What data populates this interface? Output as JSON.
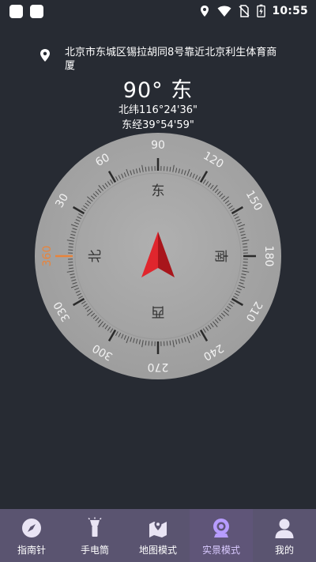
{
  "status_bar": {
    "time": "10:55",
    "icons": [
      "location-icon",
      "wifi-icon",
      "no-sim-icon",
      "battery-charging-icon"
    ]
  },
  "location": {
    "icon": "map-pin-icon",
    "address": "北京市东城区锡拉胡同8号靠近北京利生体育商厦"
  },
  "heading": {
    "text": "90°  东"
  },
  "coordinates": {
    "latitude": "北纬116°24'36\"",
    "longitude": "东经39°54'59\""
  },
  "compass": {
    "labels": [
      "90",
      "120",
      "150",
      "180",
      "210",
      "240",
      "270",
      "300",
      "330",
      "360",
      "30",
      "60"
    ],
    "directions": {
      "east": "东",
      "south": "南",
      "west": "西",
      "north": "北"
    },
    "highlight_label": "360",
    "highlight_color": "#E8843C",
    "needle_color": "#E0262D"
  },
  "nav": {
    "items": [
      {
        "label": "指南针",
        "icon": "compass-icon",
        "active": false
      },
      {
        "label": "手电筒",
        "icon": "flashlight-icon",
        "active": false
      },
      {
        "label": "地图模式",
        "icon": "map-icon",
        "active": false
      },
      {
        "label": "实景模式",
        "icon": "camera-icon",
        "active": true
      },
      {
        "label": "我的",
        "icon": "user-icon",
        "active": false
      }
    ]
  },
  "colors": {
    "background": "#272B33",
    "dial": "#A7A7A7",
    "nav_bar": "#5A5470",
    "accent": "#B79CFF"
  }
}
